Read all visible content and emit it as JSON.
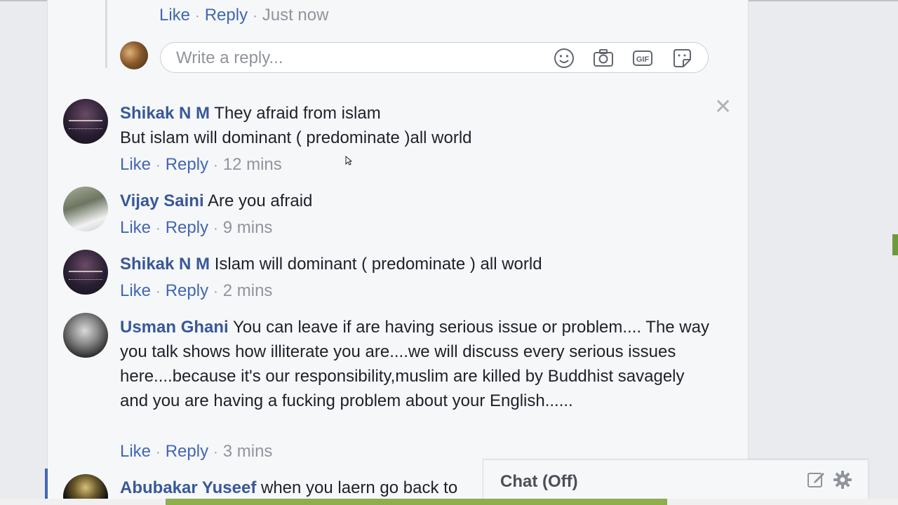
{
  "previous_reply": {
    "like": "Like",
    "reply": "Reply",
    "time": "Just now"
  },
  "reply_box": {
    "placeholder": "Write a reply...",
    "icons": [
      "smiley-icon",
      "camera-icon",
      "gif-icon",
      "sticker-icon"
    ]
  },
  "comments": [
    {
      "author": "Shikak N M",
      "text": "They afraid from islam\nBut islam will dominant ( predominate )all world",
      "like": "Like",
      "reply": "Reply",
      "time": "12 mins"
    },
    {
      "author": "Vijay Saini",
      "text": "Are you afraid",
      "like": "Like",
      "reply": "Reply",
      "time": "9 mins"
    },
    {
      "author": "Shikak N M",
      "text": "Islam will dominant ( predominate ) all world",
      "like": "Like",
      "reply": "Reply",
      "time": "2 mins"
    },
    {
      "author": "Usman Ghani",
      "text": "You can leave if are having serious issue or problem.... The way you talk shows how illiterate you are....we will discuss every serious issues here....because it's our responsibility,muslim are killed by Buddhist savagely and you are having a fucking problem about your English......",
      "like": "Like",
      "reply": "Reply",
      "time": "3 mins"
    },
    {
      "author": "Abubakar Yuseef",
      "text": "when you laern go back to"
    }
  ],
  "chat": {
    "label": "Chat (Off)",
    "icons": [
      "compose-icon",
      "gear-icon"
    ]
  },
  "colors": {
    "link": "#4267b2",
    "author": "#385898",
    "meta": "#90949c",
    "text": "#1d2129",
    "accent": "#8cae4c"
  }
}
